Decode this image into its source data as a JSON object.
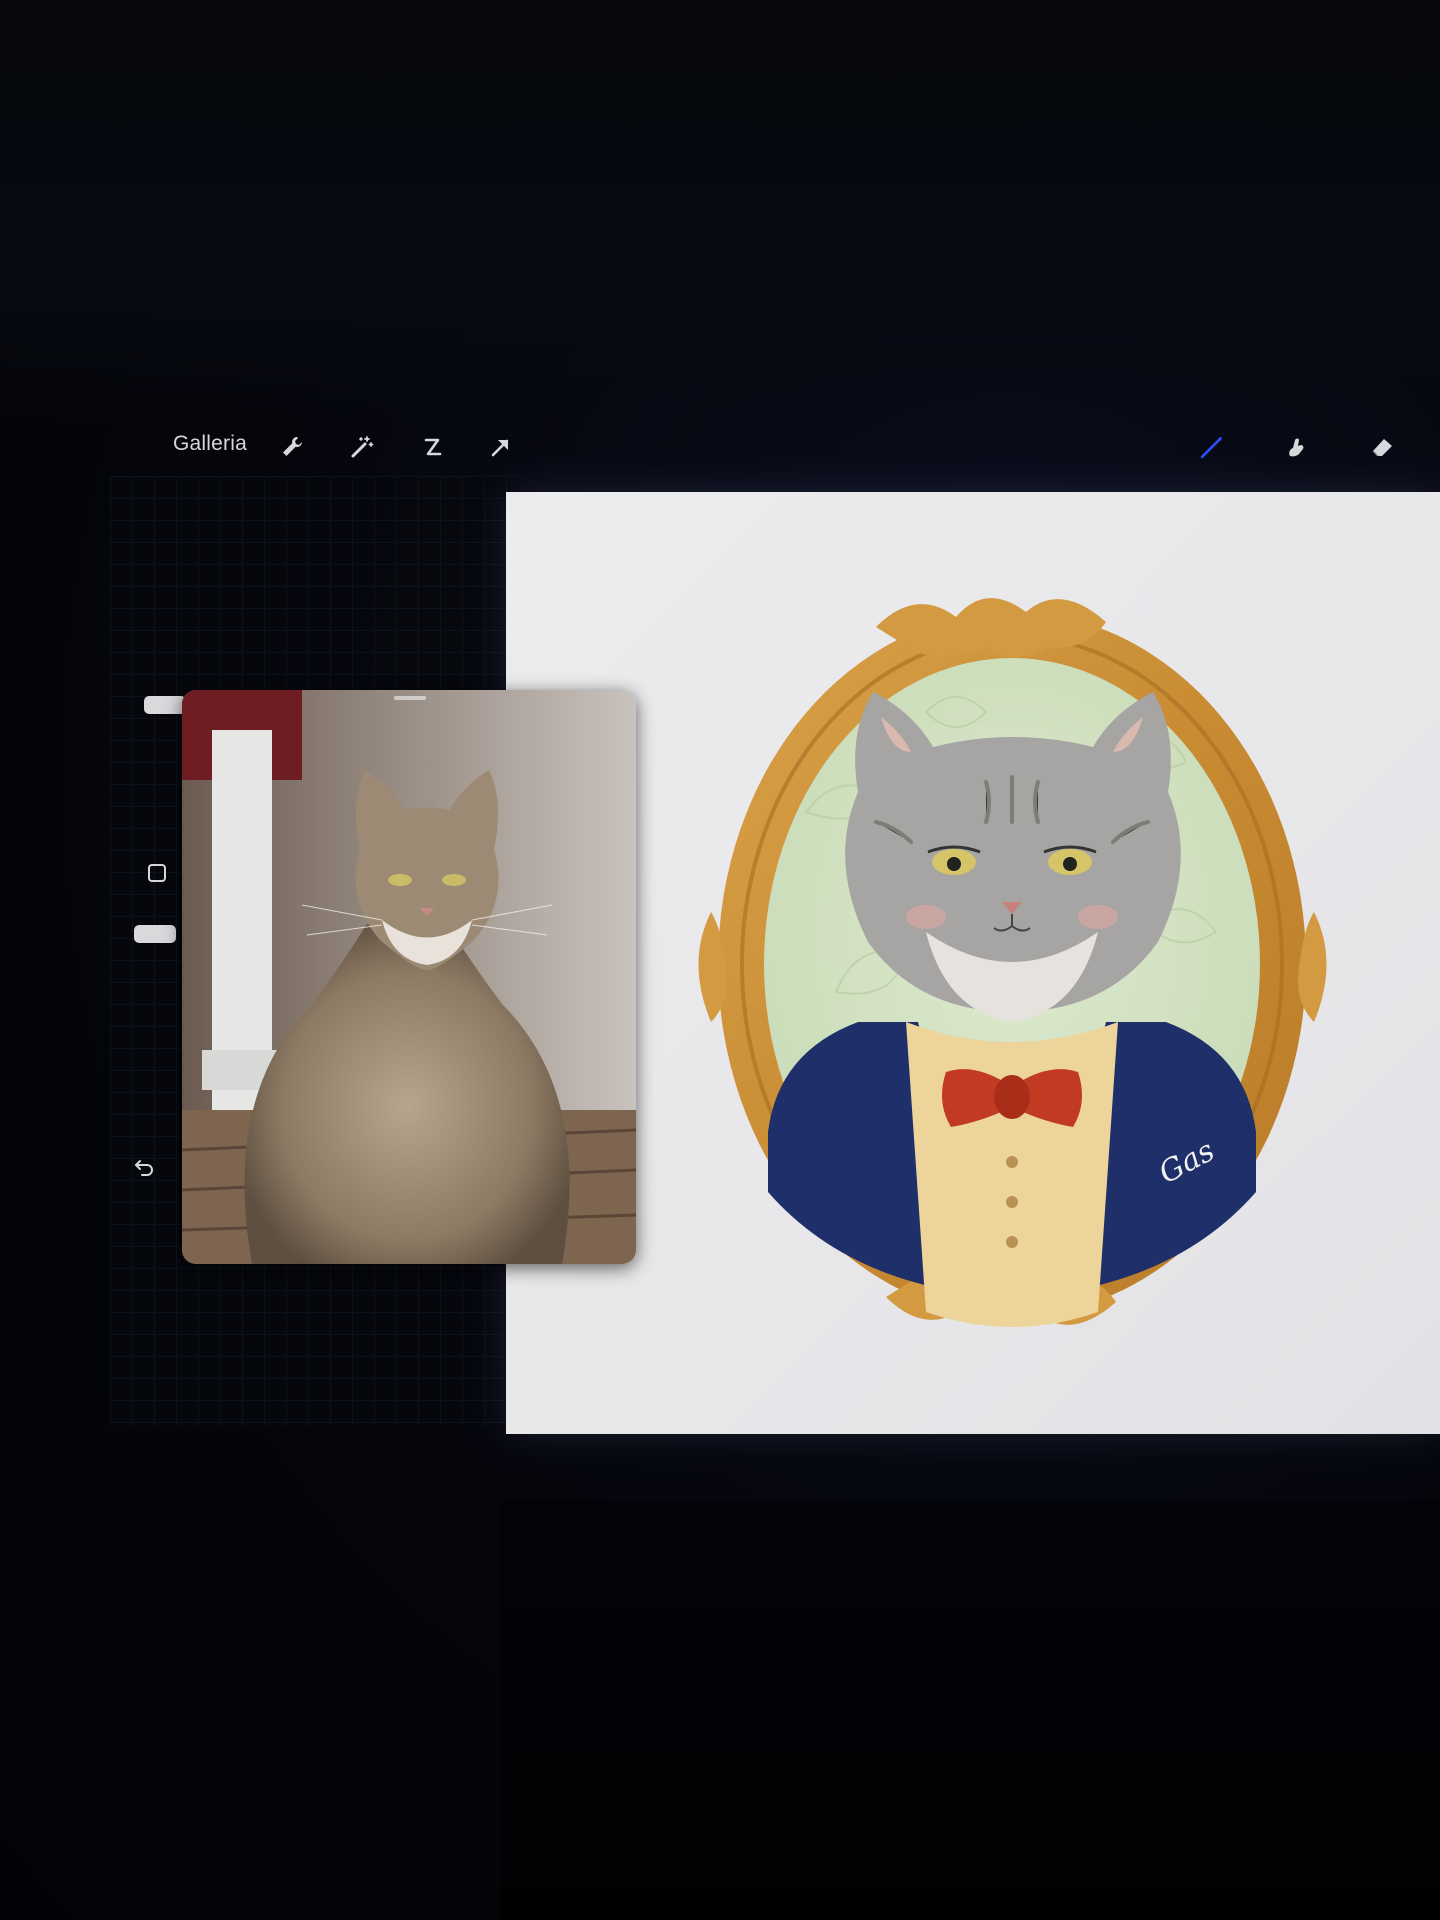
{
  "toolbar": {
    "gallery_label": "Galleria",
    "left_tools": [
      "wrench-icon",
      "magic-wand-icon",
      "selection-icon",
      "transform-arrow-icon"
    ],
    "right_tools": [
      "brush-icon",
      "smudge-icon",
      "eraser-icon"
    ],
    "active_tool_color": "#2f4fff"
  },
  "sidebar": {
    "controls": [
      "brush-size-slider",
      "modify-button",
      "opacity-slider",
      "undo-button"
    ]
  },
  "canvas": {
    "background": "#e9e9ec",
    "frame_color": "#c9903a",
    "mat_color": "#d8e6c9",
    "jacket_color": "#1f2f6a",
    "bow_color": "#c23a22",
    "signature": "Gas"
  },
  "reference": {
    "subject": "tabby-cat-photo"
  }
}
